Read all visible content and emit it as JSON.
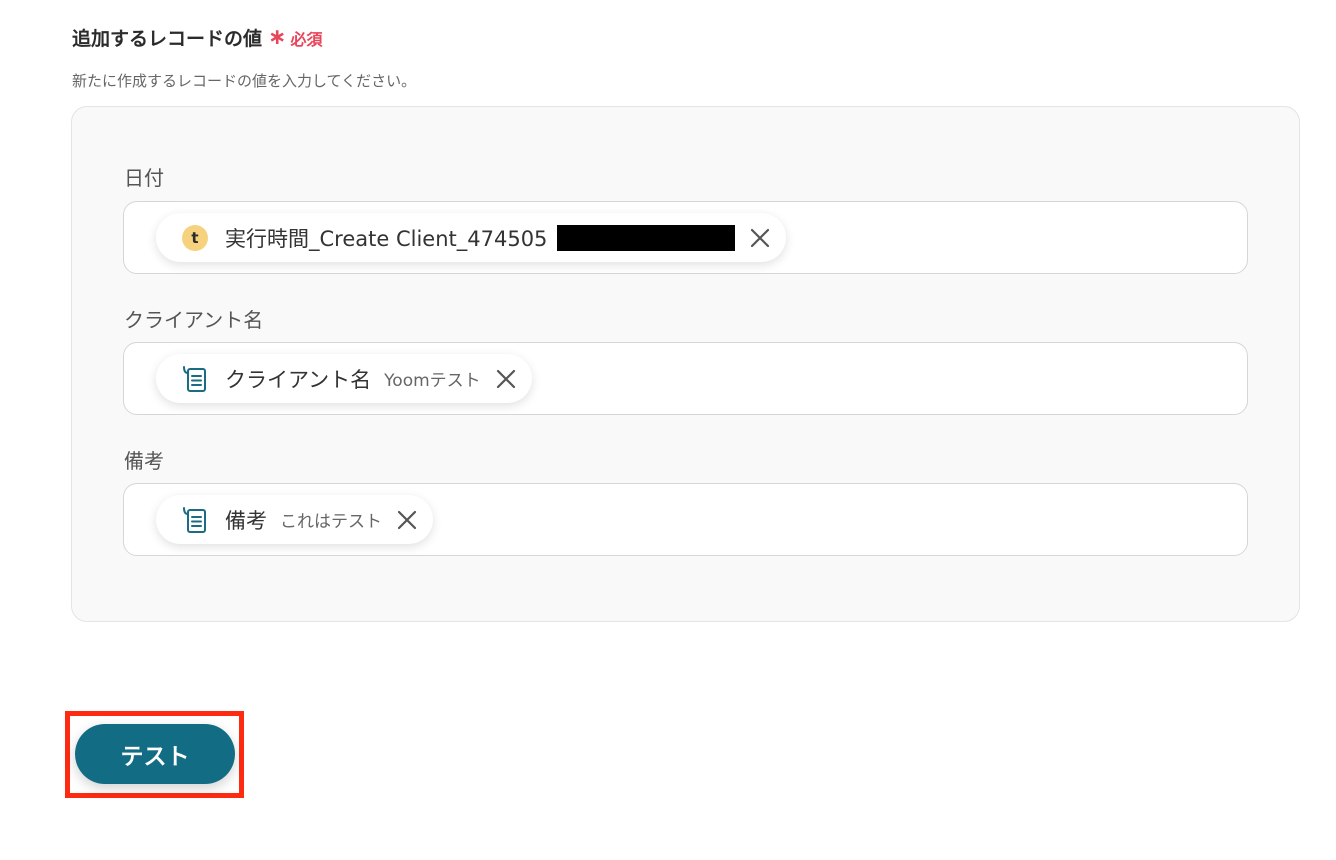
{
  "section": {
    "title": "追加するレコードの値",
    "required_mark": "∗",
    "required_label": "必須",
    "description": "新たに作成するレコードの値を入力してください。"
  },
  "fields": [
    {
      "label": "日付",
      "chip": {
        "name": "実行時間_Create Client_474505",
        "value": "",
        "icon": "t-badge-icon",
        "redacted": true
      }
    },
    {
      "label": "クライアント名",
      "chip": {
        "name": "クライアント名",
        "value": "Yoomテスト",
        "icon": "document-list-icon"
      }
    },
    {
      "label": "備考",
      "chip": {
        "name": "備考",
        "value": "これはテスト",
        "icon": "document-list-icon"
      }
    }
  ],
  "t_badge_letter": "t",
  "test_button": {
    "label": "テスト"
  },
  "colors": {
    "accent": "#126d84",
    "required": "#e8455a",
    "highlight": "#ff2a12",
    "badge": "#f7d27e"
  }
}
